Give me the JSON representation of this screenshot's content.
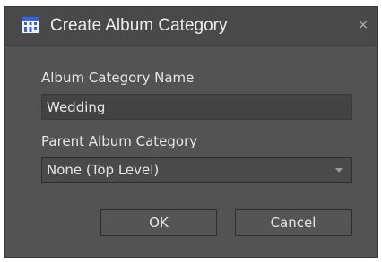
{
  "dialog": {
    "title": "Create Album Category",
    "close_label": "×",
    "icon": "calendar-grid-icon"
  },
  "form": {
    "name_label": "Album Category Name",
    "name_value": "Wedding",
    "parent_label": "Parent Album Category",
    "parent_value": "None (Top Level)"
  },
  "buttons": {
    "ok_label": "OK",
    "cancel_label": "Cancel"
  },
  "colors": {
    "background": "#535353",
    "titlebar": "#494949",
    "icon_blue": "#3b64c5"
  }
}
